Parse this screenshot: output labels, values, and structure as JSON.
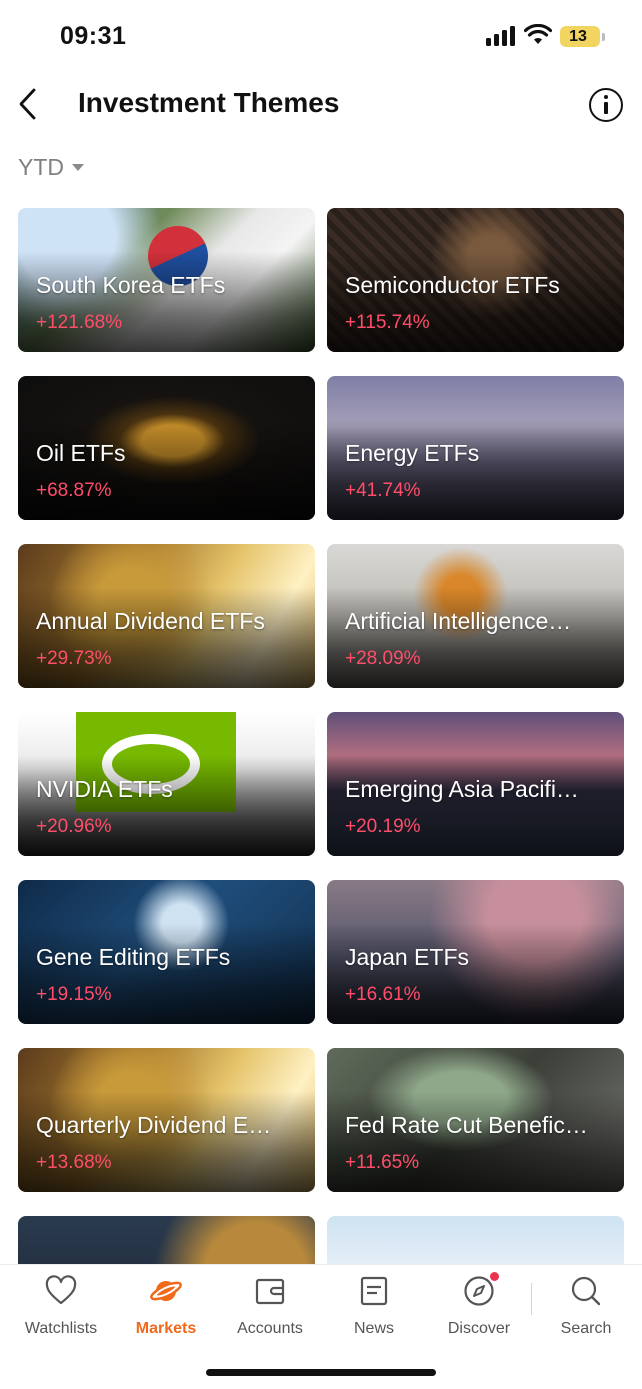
{
  "status_bar": {
    "time": "09:31",
    "battery": "13"
  },
  "header": {
    "title": "Investment Themes"
  },
  "filter": {
    "period": "YTD"
  },
  "themes": [
    {
      "name": "South Korea ETFs",
      "change": "+121.68%"
    },
    {
      "name": "Semiconductor ETFs",
      "change": "+115.74%"
    },
    {
      "name": "Oil ETFs",
      "change": "+68.87%"
    },
    {
      "name": "Energy ETFs",
      "change": "+41.74%"
    },
    {
      "name": "Annual Dividend ETFs",
      "change": "+29.73%"
    },
    {
      "name": "Artificial Intelligence…",
      "change": "+28.09%"
    },
    {
      "name": "NVIDIA ETFs",
      "change": "+20.96%"
    },
    {
      "name": "Emerging Asia Pacifi…",
      "change": "+20.19%"
    },
    {
      "name": "Gene Editing ETFs",
      "change": "+19.15%"
    },
    {
      "name": "Japan ETFs",
      "change": "+16.61%"
    },
    {
      "name": "Quarterly Dividend E…",
      "change": "+13.68%"
    },
    {
      "name": "Fed Rate Cut Benefic…",
      "change": "+11.65%"
    }
  ],
  "colors": {
    "accent": "#f06a1b",
    "positive": "#ff4d6a"
  },
  "tabs": [
    {
      "label": "Watchlists",
      "icon": "heart-icon"
    },
    {
      "label": "Markets",
      "icon": "planet-icon"
    },
    {
      "label": "Accounts",
      "icon": "wallet-icon"
    },
    {
      "label": "News",
      "icon": "news-icon"
    },
    {
      "label": "Discover",
      "icon": "compass-icon"
    },
    {
      "label": "Search",
      "icon": "search-icon"
    }
  ]
}
